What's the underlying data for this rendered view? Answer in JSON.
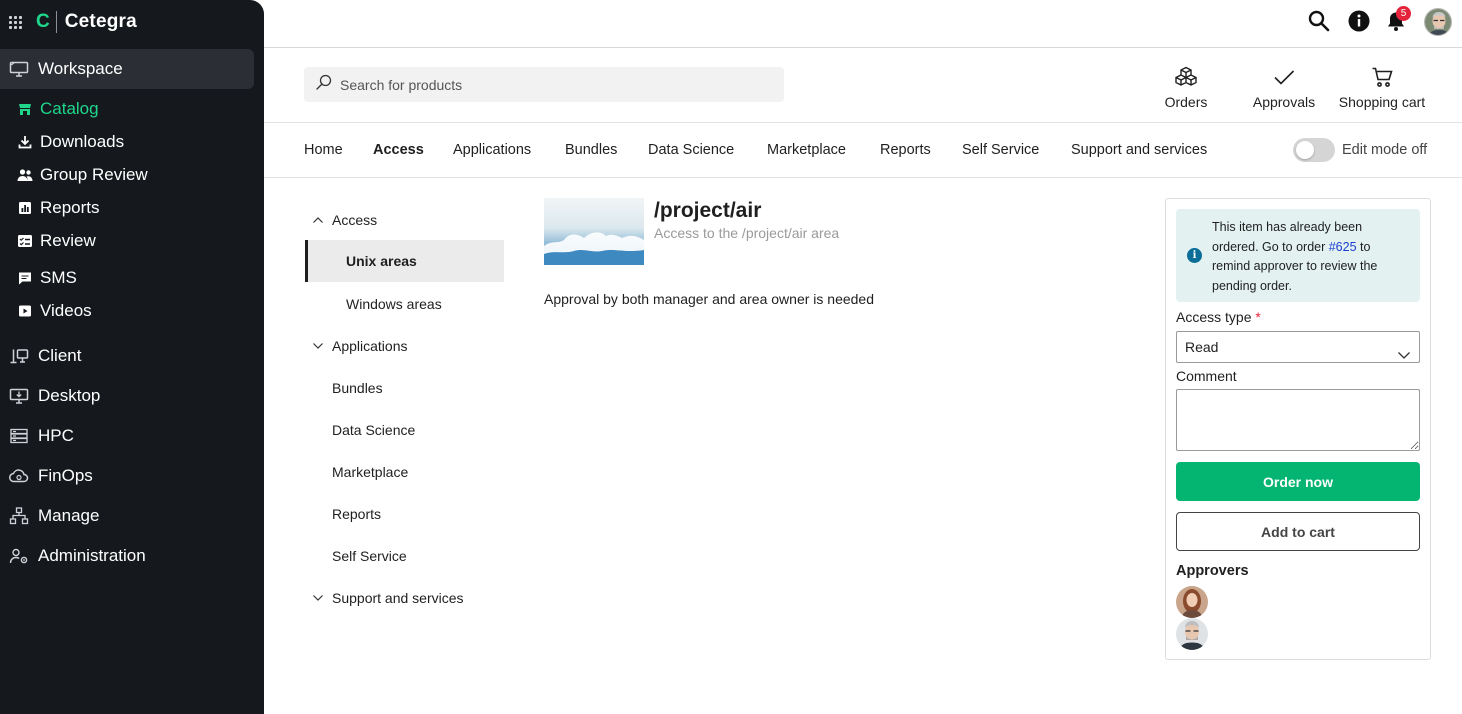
{
  "brand": {
    "logo_letter": "C",
    "name": "Cetegra",
    "accent": "#1fd68b"
  },
  "sidebar": {
    "items": [
      {
        "label": "Workspace",
        "icon": "monitor-icon",
        "active": true
      },
      {
        "label": "Catalog",
        "icon": "store-icon",
        "current": true
      },
      {
        "label": "Downloads",
        "icon": "download-icon"
      },
      {
        "label": "Group Review",
        "icon": "users-icon"
      },
      {
        "label": "Reports",
        "icon": "bar-chart-icon"
      },
      {
        "label": "Review",
        "icon": "checklist-icon"
      },
      {
        "label": "SMS",
        "icon": "chat-icon"
      },
      {
        "label": "Videos",
        "icon": "play-icon"
      },
      {
        "label": "Client",
        "icon": "client-icon"
      },
      {
        "label": "Desktop",
        "icon": "desktop-icon"
      },
      {
        "label": "HPC",
        "icon": "server-icon"
      },
      {
        "label": "FinOps",
        "icon": "cloud-money-icon"
      },
      {
        "label": "Manage",
        "icon": "hierarchy-icon"
      },
      {
        "label": "Administration",
        "icon": "user-gear-icon"
      }
    ]
  },
  "topbar": {
    "notification_count": "5"
  },
  "search": {
    "placeholder": "Search for products",
    "value": ""
  },
  "quick_actions": {
    "orders": "Orders",
    "approvals": "Approvals",
    "cart": "Shopping cart"
  },
  "tabs": [
    "Home",
    "Access",
    "Applications",
    "Bundles",
    "Data Science",
    "Marketplace",
    "Reports",
    "Self Service",
    "Support and services"
  ],
  "active_tab": "Access",
  "edit_mode": {
    "label": "Edit mode off",
    "on": false
  },
  "tree": {
    "access": "Access",
    "unix": "Unix areas",
    "windows": "Windows areas",
    "applications": "Applications",
    "bundles": "Bundles",
    "data_science": "Data Science",
    "marketplace": "Marketplace",
    "reports": "Reports",
    "self_service": "Self Service",
    "support": "Support and services"
  },
  "product": {
    "title": "/project/air",
    "subtitle": "Access to the /project/air area",
    "description": "Approval by both manager and area owner is needed"
  },
  "order_panel": {
    "notice_before": "This item has already been ordered. Go to order ",
    "notice_link": "#625",
    "notice_after": " to remind approver to review the pending order.",
    "access_type_label": "Access type",
    "required_mark": "*",
    "access_type_value": "Read",
    "comment_label": "Comment",
    "comment_value": "",
    "order_now": "Order now",
    "add_to_cart": "Add to cart",
    "approvers_title": "Approvers"
  }
}
